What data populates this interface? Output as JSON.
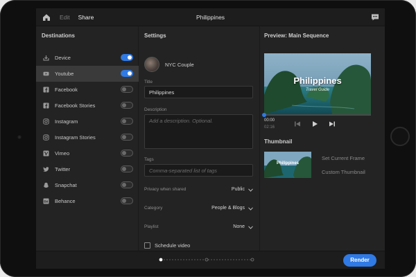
{
  "topbar": {
    "edit_tab": "Edit",
    "share_tab": "Share",
    "project_title": "Philippines",
    "icons": {
      "home": "home-icon",
      "chat": "chat-icon"
    }
  },
  "destinations": {
    "heading": "Destinations",
    "items": [
      {
        "label": "Device",
        "icon": "download-icon",
        "enabled": true,
        "selected": false
      },
      {
        "label": "Youtube",
        "icon": "youtube-icon",
        "enabled": true,
        "selected": true
      },
      {
        "label": "Facebook",
        "icon": "facebook-icon",
        "enabled": false,
        "selected": false
      },
      {
        "label": "Facebook Stories",
        "icon": "facebook-icon",
        "enabled": false,
        "selected": false
      },
      {
        "label": "Instagram",
        "icon": "instagram-icon",
        "enabled": false,
        "selected": false
      },
      {
        "label": "Instagram Stories",
        "icon": "instagram-icon",
        "enabled": false,
        "selected": false
      },
      {
        "label": "Vimeo",
        "icon": "vimeo-icon",
        "enabled": false,
        "selected": false
      },
      {
        "label": "Twitter",
        "icon": "twitter-icon",
        "enabled": false,
        "selected": false
      },
      {
        "label": "Snapchat",
        "icon": "snapchat-icon",
        "enabled": false,
        "selected": false
      },
      {
        "label": "Behance",
        "icon": "behance-icon",
        "enabled": false,
        "selected": false
      }
    ]
  },
  "settings": {
    "heading": "Settings",
    "account_name": "NYC Couple",
    "title_label": "Title",
    "title_value": "Philippines",
    "description_label": "Description",
    "description_placeholder": "Add a description. Optional.",
    "tags_label": "Tags",
    "tags_placeholder": "Comma-separated list of tags",
    "privacy_label": "Privacy when shared",
    "privacy_value": "Public",
    "category_label": "Category",
    "category_value": "People & Blogs",
    "playlist_label": "Playlist",
    "playlist_value": "None",
    "schedule_label": "Schedule video",
    "schedule_checked": false
  },
  "preview": {
    "heading": "Preview: Main Sequence",
    "overlay_title": "Philippines",
    "overlay_subtitle": "Travel Guide",
    "current_time": "00:00",
    "total_time": "02:16",
    "progress": 0.0
  },
  "thumbnail": {
    "heading": "Thumbnail",
    "overlay_title": "Philippines",
    "set_current_frame": "Set Current Frame",
    "custom_thumbnail": "Custom Thumbnail"
  },
  "footer": {
    "render_label": "Render",
    "pager_steps": 3,
    "pager_active": 0
  },
  "colors": {
    "accent": "#2f7ae5",
    "panel": "#232323",
    "bar": "#1d1d1d"
  }
}
